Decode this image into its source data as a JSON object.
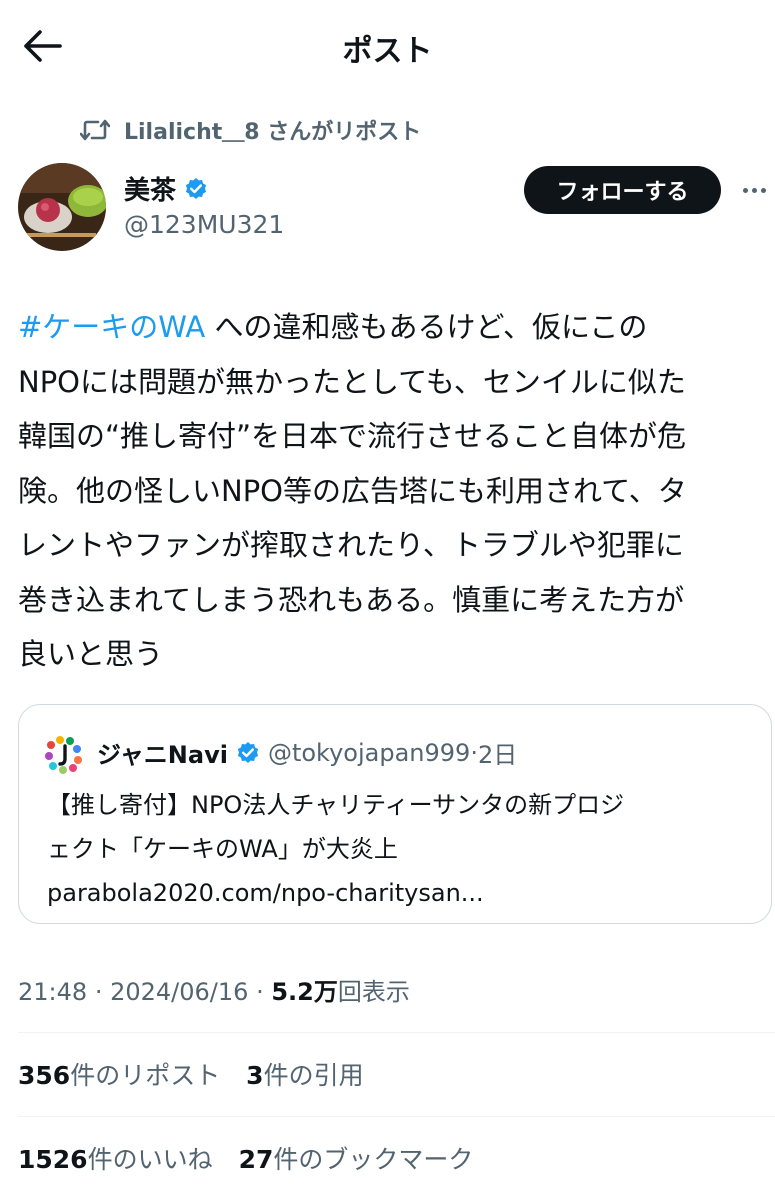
{
  "header": {
    "title": "ポスト",
    "back_icon": "arrow-left-icon"
  },
  "repost": {
    "text": "Lilalicht＿8 さんがリポスト",
    "icon": "retweet-icon"
  },
  "author": {
    "display_name": "美茶",
    "handle": "@123MU321",
    "verified": true,
    "follow_label": "フォローする"
  },
  "tweet": {
    "hashtag": "#ケーキのWA",
    "lines": [
      " への違和感もあるけど、仮にこの",
      "NPOには問題が無かったとしても、センイルに似た",
      "韓国の“推し寄付”を日本で流行させること自体が危",
      "険。他の怪しいNPO等の広告塔にも利用されて、タ",
      "レントやファンが搾取されたり、トラブルや犯罪に",
      "巻き込まれてしまう恐れもある。慎重に考えた方が",
      "良いと思う"
    ]
  },
  "quote": {
    "name": "ジャニNavi",
    "handle": "@tokyojapan999",
    "separator": "·",
    "time": "2日",
    "verified": true,
    "lines": [
      "【推し寄付】NPO法人チャリティーサンタの新プロジ",
      "ェクト「ケーキのWA」が大炎上",
      "parabola2020.com/npo-charitysan..."
    ]
  },
  "meta": {
    "time": "21:48",
    "separator": "·",
    "date": "2024/06/16",
    "separator2": "·",
    "views_num": "5.2万",
    "views_label": "回表示"
  },
  "stats": {
    "reposts_num": "356",
    "reposts_label": "件のリポスト",
    "quotes_num": "3",
    "quotes_label": "件の引用",
    "likes_num": "1526",
    "likes_label": "件のいいね",
    "bookmarks_num": "27",
    "bookmarks_label": "件のブックマーク"
  },
  "colors": {
    "accent": "#1d9bf0",
    "text": "#0f1419",
    "secondary": "#536471",
    "border": "#cfd9de"
  }
}
